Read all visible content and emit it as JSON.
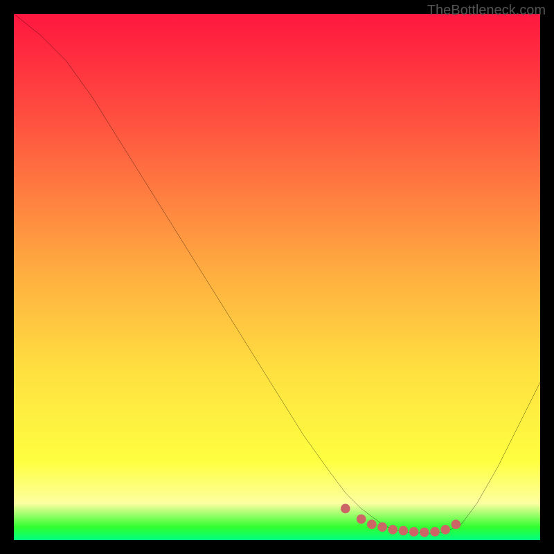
{
  "watermark": "TheBottleneck.com",
  "chart_data": {
    "type": "line",
    "title": "",
    "xlabel": "",
    "ylabel": "",
    "xlim": [
      0,
      100
    ],
    "ylim": [
      0,
      100
    ],
    "grid": false,
    "legend": false,
    "series": [
      {
        "name": "curve",
        "x": [
          0,
          5,
          10,
          15,
          20,
          25,
          30,
          35,
          40,
          45,
          50,
          55,
          60,
          63,
          66,
          70,
          72,
          75,
          78,
          80,
          82,
          85,
          88,
          92,
          96,
          100
        ],
        "values": [
          100,
          96,
          91,
          84,
          76,
          68,
          60,
          52,
          44,
          36,
          28,
          20,
          13,
          9,
          6,
          3,
          2,
          1.5,
          1.3,
          1.3,
          1.5,
          3,
          7,
          14,
          22,
          30
        ]
      }
    ],
    "dots": {
      "name": "highlight-dots",
      "color": "#cc6666",
      "x": [
        63,
        66,
        68,
        70,
        72,
        74,
        76,
        78,
        80,
        82,
        84
      ],
      "values": [
        6,
        4,
        3,
        2.5,
        2,
        1.8,
        1.6,
        1.5,
        1.6,
        2,
        3
      ]
    },
    "background_gradient": {
      "top": "#ff173f",
      "stops": [
        "#ff5040",
        "#ffb040",
        "#ffe040",
        "#feff40"
      ],
      "bottom": "#00ff80"
    }
  }
}
